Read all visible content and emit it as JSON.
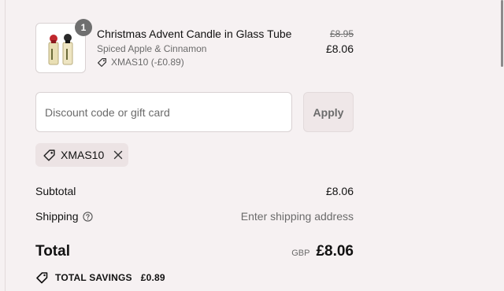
{
  "cart": {
    "item": {
      "quantity": "1",
      "name": "Christmas Advent Candle in Glass Tube",
      "variant": "Spiced Apple & Cinnamon",
      "discount_tag": "XMAS10 (-£0.89)",
      "original_price": "£8.95",
      "price": "£8.06",
      "image_icon": "candle-product-image"
    }
  },
  "discount": {
    "placeholder": "Discount code or gift card",
    "value": "",
    "apply_label": "Apply",
    "applied_code": "XMAS10"
  },
  "summary": {
    "subtotal_label": "Subtotal",
    "subtotal_value": "£8.06",
    "shipping_label": "Shipping",
    "shipping_value": "Enter shipping address",
    "total_label": "Total",
    "currency": "GBP",
    "total_value": "£8.06",
    "savings_label": "TOTAL SAVINGS",
    "savings_value": "£0.89"
  },
  "colors": {
    "background": "#f6f1f2",
    "chip_background": "#ece3e4",
    "muted_text": "#6b6b6b"
  }
}
